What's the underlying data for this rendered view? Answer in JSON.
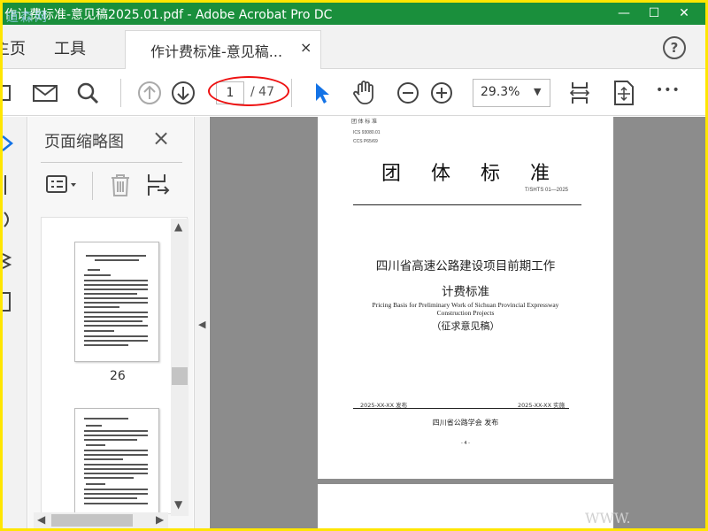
{
  "window": {
    "title": "作计费标准-意见稿2025.01.pdf - Adobe Acrobat Pro DC",
    "watermark": "道森网",
    "minimize": "—",
    "restore": "☐",
    "close": "✕"
  },
  "tabs": {
    "home": "主页",
    "tools": "工具",
    "document_tab": "作计费标准-意见稿...",
    "close": "×",
    "help": "?"
  },
  "toolbar": {
    "current_page": "1",
    "total_pages": "/ 47",
    "zoom": "29.3%",
    "zoom_arrow": "▼",
    "more": "•••",
    "annotation_color": "#e11111"
  },
  "thumbnails": {
    "heading": "页面缩略图",
    "close": "×",
    "page_label": "26"
  },
  "document": {
    "ics": "ICS 93080.01",
    "ccs": "CCS P65/69",
    "header_cut": "团 体 标 准",
    "title": "团体标准",
    "code": "T/SHTS 01—2025",
    "main_title_line1": "四川省高速公路建设项目前期工作",
    "main_title_line2": "计费标准",
    "english_line1": "Pricing Basis for Preliminary Work of Sichuan Provincial Expressway",
    "english_line2": "Construction Projects",
    "status": "（征求意见稿）",
    "publish_date": "2025-XX-XX 发布",
    "implement_date": "2025-XX-XX 实施",
    "publisher": "四川省公路学会  发布",
    "page_number": "- 4 -"
  },
  "site_watermark": "WWW.",
  "colors": {
    "titlebar": "#1a8f3c",
    "frame": "#ffe600",
    "doc_background": "#8c8c8c",
    "select_tool": "#1473e6"
  }
}
